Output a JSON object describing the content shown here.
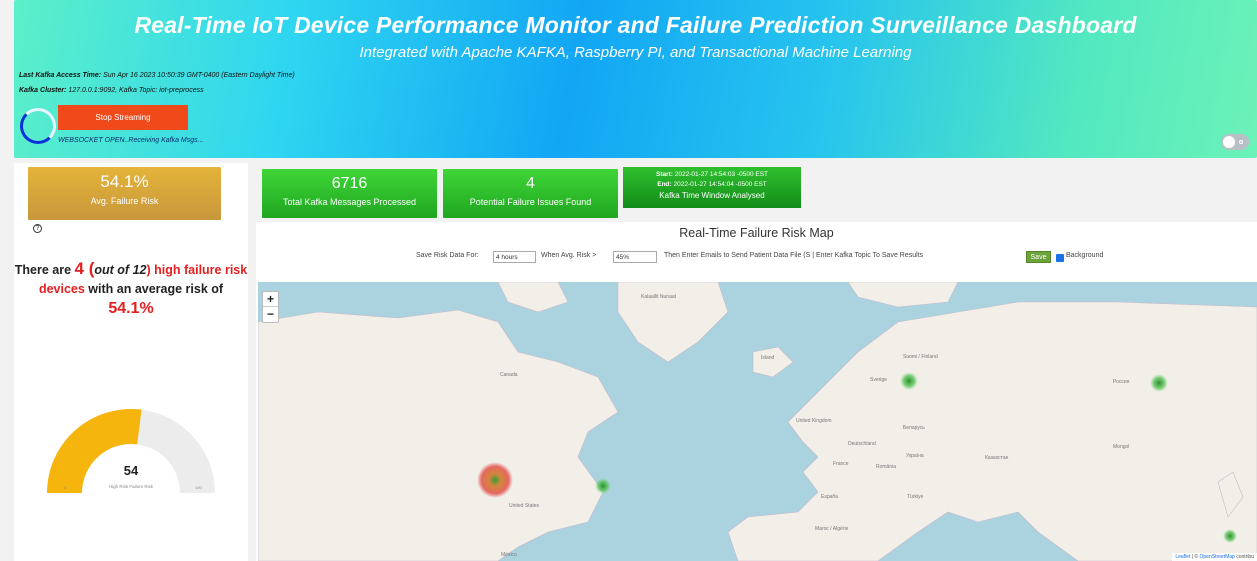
{
  "header": {
    "title": "Real-Time IoT Device Performance Monitor and Failure Prediction Surveillance Dashboard",
    "subtitle": "Integrated with Apache KAFKA, Raspberry PI, and Transactional Machine Learning",
    "last_access_label": "Last Kafka Access Time:",
    "last_access_value": "Sun Apr 16 2023 10:50:39 GMT-0400 (Eastern Daylight Time)",
    "cluster_label": "Kafka Cluster:",
    "cluster_value": "127.0.0.1:9092, Kafka Topic: iot-preprocess",
    "stop_button": "Stop Streaming",
    "ws_status": "WEBSOCKET OPEN..Receiving Kafka Msgs..."
  },
  "left": {
    "avg_risk_value": "54.1%",
    "avg_risk_label": "Avg. Failure Risk",
    "help_icon": "?",
    "summary": {
      "p1": "There are ",
      "count": "4",
      "paren_open": " (",
      "out_of": "out of 12",
      "paren_close": ")",
      "high": " high failure risk devices",
      "p2": " with an average risk of",
      "pct": "54.1%"
    },
    "gauge": {
      "value": 54,
      "value_text": "54",
      "min": "0",
      "max": "100",
      "label": "High Risk Failure Risk",
      "fill_color": "#f5b50c",
      "track_color": "#ececec"
    }
  },
  "stats": {
    "messages_value": "6716",
    "messages_label": "Total Kafka Messages Processed",
    "issues_value": "4",
    "issues_label": "Potential Failure Issues Found",
    "start_label": "Start:",
    "start_value": "2022-01-27 14:54:03 -0500 EST",
    "end_label": "End:",
    "end_value": "2022-01-27 14:54:04 -0500 EST",
    "window_label": "Kafka Time Window Analysed"
  },
  "map": {
    "title": "Real-Time Failure Risk Map",
    "save_for_label": "Save Risk Data For:",
    "save_for_value": "4 hours",
    "when_label": "When Avg. Risk >",
    "when_value": "45%",
    "instructions": "Then Enter Emails to Send Patient Data File (S | Enter Kafka Topic To Save Results",
    "save_button": "Save",
    "background_label": "Background",
    "zoom_in": "+",
    "zoom_out": "−",
    "attr_leaflet": "Leaflet",
    "attr_sep": " | © ",
    "attr_osm": "OpenStreetMap",
    "attr_tail": " contribu",
    "places": [
      "Kalaallit Nunaat",
      "Canada",
      "Ísland",
      "Sverige",
      "Suomi / Finland",
      "Россия",
      "United Kingdom",
      "Беларусь",
      "Deutschland",
      "Україна",
      "France",
      "România",
      "Казахстан",
      "España",
      "Türkiye",
      "United States",
      "Maroc / Algérie",
      "México",
      "Mongol"
    ]
  }
}
